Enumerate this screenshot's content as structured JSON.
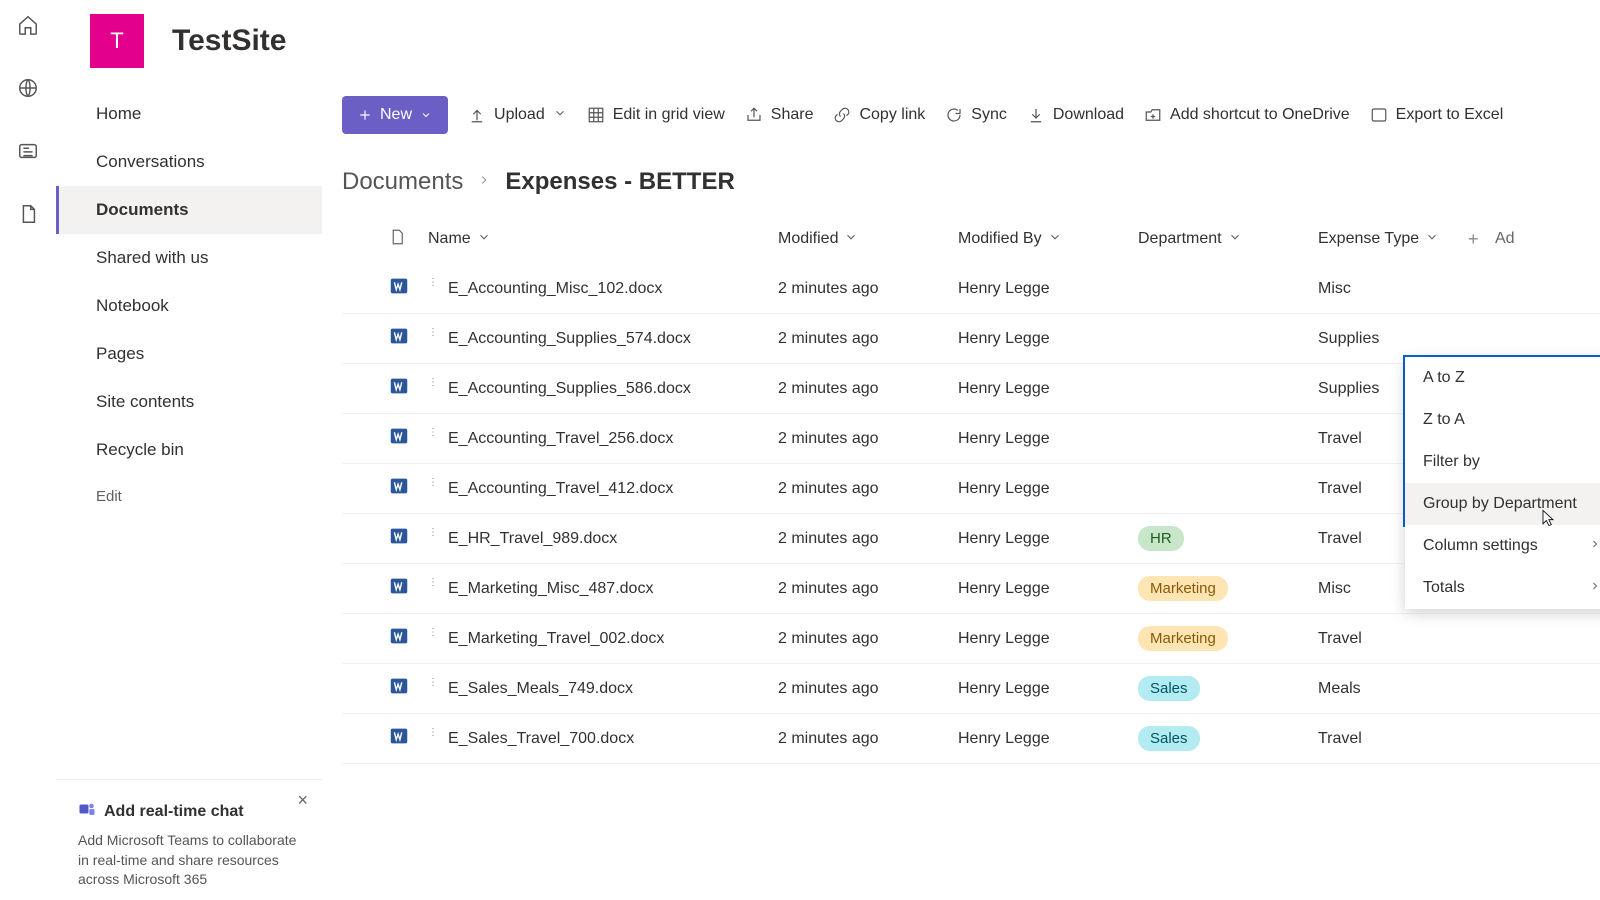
{
  "site": {
    "logo_letter": "T",
    "title": "TestSite"
  },
  "rail_icons": [
    "home-icon",
    "globe-icon",
    "news-icon",
    "file-icon"
  ],
  "nav": {
    "items": [
      {
        "label": "Home"
      },
      {
        "label": "Conversations"
      },
      {
        "label": "Documents",
        "selected": true
      },
      {
        "label": "Shared with us"
      },
      {
        "label": "Notebook"
      },
      {
        "label": "Pages"
      },
      {
        "label": "Site contents"
      },
      {
        "label": "Recycle bin"
      }
    ],
    "edit_label": "Edit"
  },
  "promo": {
    "title": "Add real-time chat",
    "body": "Add Microsoft Teams to collaborate in real-time and share resources across Microsoft 365"
  },
  "toolbar": {
    "new_label": "New",
    "upload_label": "Upload",
    "edit_grid_label": "Edit in grid view",
    "share_label": "Share",
    "copylink_label": "Copy link",
    "sync_label": "Sync",
    "download_label": "Download",
    "shortcut_label": "Add shortcut to OneDrive",
    "export_label": "Export to Excel"
  },
  "breadcrumb": {
    "root": "Documents",
    "leaf": "Expenses - BETTER"
  },
  "columns": {
    "name": "Name",
    "modified": "Modified",
    "modified_by": "Modified By",
    "department": "Department",
    "expense_type": "Expense Type",
    "add": "Ad"
  },
  "rows": [
    {
      "name": "E_Accounting_Misc_102.docx",
      "modified": "2 minutes ago",
      "modified_by": "Henry Legge",
      "dept": "",
      "exp": "Misc"
    },
    {
      "name": "E_Accounting_Supplies_574.docx",
      "modified": "2 minutes ago",
      "modified_by": "Henry Legge",
      "dept": "",
      "exp": "Supplies"
    },
    {
      "name": "E_Accounting_Supplies_586.docx",
      "modified": "2 minutes ago",
      "modified_by": "Henry Legge",
      "dept": "",
      "exp": "Supplies"
    },
    {
      "name": "E_Accounting_Travel_256.docx",
      "modified": "2 minutes ago",
      "modified_by": "Henry Legge",
      "dept": "",
      "exp": "Travel"
    },
    {
      "name": "E_Accounting_Travel_412.docx",
      "modified": "2 minutes ago",
      "modified_by": "Henry Legge",
      "dept": "",
      "exp": "Travel"
    },
    {
      "name": "E_HR_Travel_989.docx",
      "modified": "2 minutes ago",
      "modified_by": "Henry Legge",
      "dept": "HR",
      "exp": "Travel"
    },
    {
      "name": "E_Marketing_Misc_487.docx",
      "modified": "2 minutes ago",
      "modified_by": "Henry Legge",
      "dept": "Marketing",
      "exp": "Misc"
    },
    {
      "name": "E_Marketing_Travel_002.docx",
      "modified": "2 minutes ago",
      "modified_by": "Henry Legge",
      "dept": "Marketing",
      "exp": "Travel"
    },
    {
      "name": "E_Sales_Meals_749.docx",
      "modified": "2 minutes ago",
      "modified_by": "Henry Legge",
      "dept": "Sales",
      "exp": "Meals"
    },
    {
      "name": "E_Sales_Travel_700.docx",
      "modified": "2 minutes ago",
      "modified_by": "Henry Legge",
      "dept": "Sales",
      "exp": "Travel"
    }
  ],
  "menu": {
    "az": "A to Z",
    "za": "Z to A",
    "filter": "Filter by",
    "group": "Group by Department",
    "settings": "Column settings",
    "totals": "Totals"
  }
}
